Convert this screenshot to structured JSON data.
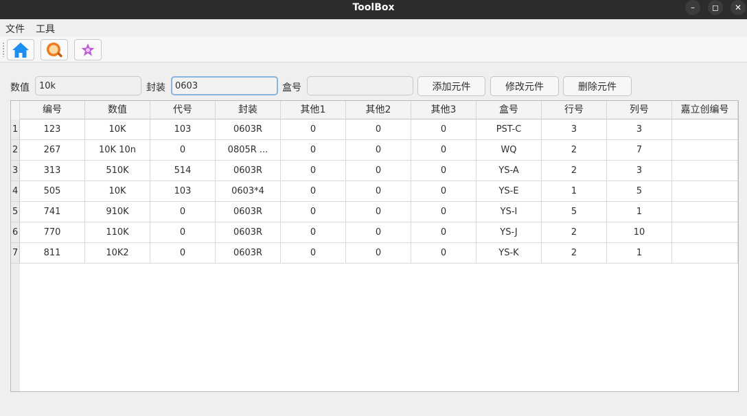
{
  "window": {
    "title": "ToolBox"
  },
  "menu": {
    "items": [
      "文件",
      "工具"
    ]
  },
  "toolbar": {
    "buttons": [
      "home-icon",
      "search-icon",
      "puzzle-icon"
    ]
  },
  "form": {
    "value_label": "数值",
    "value_input": "10k",
    "package_label": "封装",
    "package_input": "0603",
    "box_label": "盒号",
    "box_input": "",
    "add_button": "添加元件",
    "edit_button": "修改元件",
    "delete_button": "删除元件"
  },
  "table": {
    "columns": [
      "编号",
      "数值",
      "代号",
      "封装",
      "其他1",
      "其他2",
      "其他3",
      "盒号",
      "行号",
      "列号",
      "嘉立创编号"
    ],
    "row_numbers": [
      "1",
      "2",
      "3",
      "4",
      "5",
      "6",
      "7"
    ],
    "rows": [
      [
        "123",
        "10K",
        "103",
        "0603R",
        "0",
        "0",
        "0",
        "PST-C",
        "3",
        "3",
        ""
      ],
      [
        "267",
        "10K 10n",
        "0",
        "0805R ...",
        "0",
        "0",
        "0",
        "WQ",
        "2",
        "7",
        ""
      ],
      [
        "313",
        "510K",
        "514",
        "0603R",
        "0",
        "0",
        "0",
        "YS-A",
        "2",
        "3",
        ""
      ],
      [
        "505",
        "10K",
        "103",
        "0603*4",
        "0",
        "0",
        "0",
        "YS-E",
        "1",
        "5",
        ""
      ],
      [
        "741",
        "910K",
        "0",
        "0603R",
        "0",
        "0",
        "0",
        "YS-I",
        "5",
        "1",
        ""
      ],
      [
        "770",
        "110K",
        "0",
        "0603R",
        "0",
        "0",
        "0",
        "YS-J",
        "2",
        "10",
        ""
      ],
      [
        "811",
        "10K2",
        "0",
        "0603R",
        "0",
        "0",
        "0",
        "YS-K",
        "2",
        "1",
        ""
      ]
    ]
  }
}
